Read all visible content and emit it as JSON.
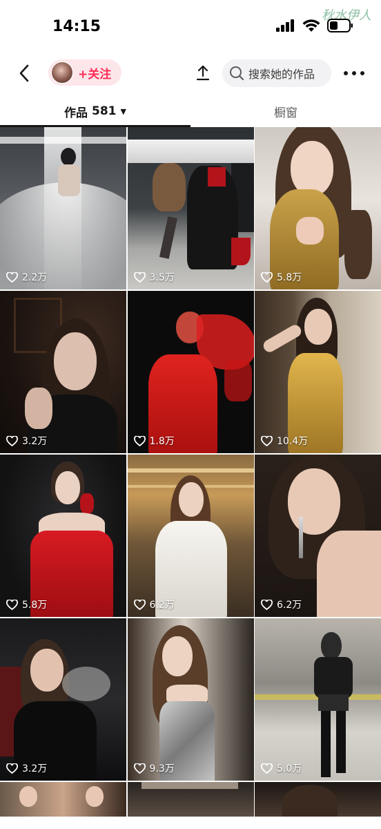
{
  "status": {
    "time": "14:15",
    "watermark": "秋水伊人"
  },
  "nav": {
    "follow_label": "+关注",
    "search_placeholder": "搜索她的作品"
  },
  "tabs": [
    {
      "label": "作品",
      "count": "581"
    },
    {
      "label": "橱窗"
    }
  ],
  "videos": [
    {
      "likes": "2.2万"
    },
    {
      "likes": "3.5万"
    },
    {
      "likes": "5.8万"
    },
    {
      "likes": "3.2万"
    },
    {
      "likes": "1.8万"
    },
    {
      "likes": "10.4万"
    },
    {
      "likes": "5.8万"
    },
    {
      "likes": "6.2万"
    },
    {
      "likes": "6.2万"
    },
    {
      "likes": "3.2万"
    },
    {
      "likes": "9.3万"
    },
    {
      "likes": "5.0万"
    }
  ],
  "colors": {
    "accent": "#fe2c55",
    "follow_bg": "#fde6ea"
  },
  "icons": [
    "back-arrow-icon",
    "share-icon",
    "search-icon",
    "more-icon",
    "heart-icon",
    "signal-icon",
    "wifi-icon",
    "battery-icon"
  ]
}
